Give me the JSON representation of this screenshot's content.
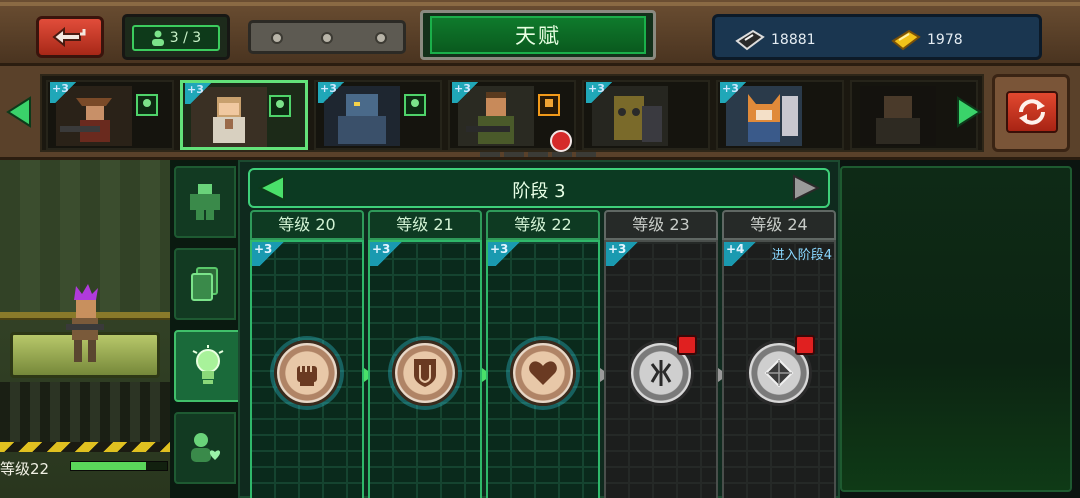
{
  "header": {
    "title": "天赋",
    "squad_count": "3 / 3",
    "currency": {
      "diamonds": "18881",
      "gold": "1978"
    }
  },
  "heroes": [
    {
      "name": "hero-cowboy",
      "plus": "+3",
      "badge": "green",
      "selected": false
    },
    {
      "name": "hero-medic",
      "plus": "+3",
      "badge": "green",
      "selected": true
    },
    {
      "name": "hero-blue-brute",
      "plus": "+3",
      "badge": "green",
      "selected": false
    },
    {
      "name": "hero-soldier",
      "plus": "+3",
      "badge": "orange",
      "selected": false
    },
    {
      "name": "hero-hazmat",
      "plus": "+3",
      "badge": "",
      "selected": false
    },
    {
      "name": "hero-fox",
      "plus": "+3",
      "badge": "",
      "selected": false
    },
    {
      "name": "hero-dark-brute",
      "plus": "",
      "badge": "",
      "selected": false
    }
  ],
  "hero_view": {
    "level_label": "等级22",
    "level_progress": 0.78
  },
  "side_tabs": [
    "armor-tab",
    "cards-tab",
    "talent-tab",
    "bond-tab"
  ],
  "talent": {
    "stage_label": "阶段 3",
    "columns": [
      {
        "level": "等级 20",
        "plus": "+3",
        "locked": false,
        "icon": "fist-icon"
      },
      {
        "level": "等级 21",
        "plus": "+3",
        "locked": false,
        "icon": "shield-icon"
      },
      {
        "level": "等级 22",
        "plus": "+3",
        "locked": false,
        "icon": "heart-icon"
      },
      {
        "level": "等级 23",
        "plus": "+3",
        "locked": true,
        "icon": "claw-icon"
      },
      {
        "level": "等级 24",
        "plus": "+4",
        "locked": true,
        "icon": "gem-icon",
        "note": "进入阶段4"
      }
    ]
  }
}
